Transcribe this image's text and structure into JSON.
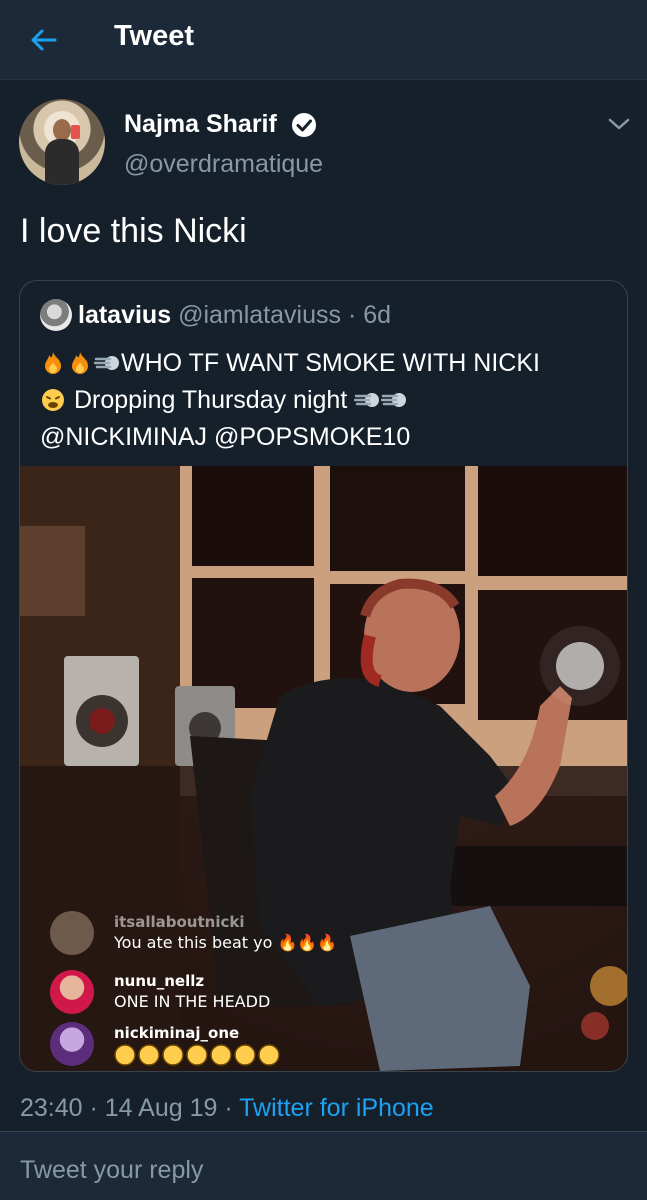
{
  "header": {
    "title": "Tweet"
  },
  "tweet": {
    "author_name": "Najma Sharif",
    "author_handle": "@overdramatique",
    "text": "I love this Nicki",
    "timestamp": "23:40 · 14 Aug 19",
    "separator": " · ",
    "source": "Twitter for iPhone"
  },
  "quote": {
    "name": "latavius",
    "handle": "@iamlataviuss",
    "separator": " · ",
    "age": "6d",
    "line1": "WHO TF WANT SMOKE WITH NICKI",
    "line2": "Dropping Thursday night",
    "line3": "@NICKIMINAJ @POPSMOKE10"
  },
  "media": {
    "comments": [
      {
        "user": "itsallaboutnicki",
        "message": "You ate this beat yo"
      },
      {
        "user": "nunu_nellz",
        "message": "ONE IN THE HEADD"
      },
      {
        "user": "nickiminaj_one",
        "message": ""
      }
    ]
  },
  "reply": {
    "placeholder": "Tweet your reply"
  },
  "colors": {
    "background": "#15202b",
    "bar": "#1c2938",
    "accent": "#1da1f2",
    "muted": "#8899a6",
    "border": "#38444d"
  },
  "icons": [
    "back-arrow-icon",
    "verified-badge-icon",
    "chevron-down-icon",
    "fire-emoji",
    "dash-emoji",
    "weary-face-emoji"
  ]
}
